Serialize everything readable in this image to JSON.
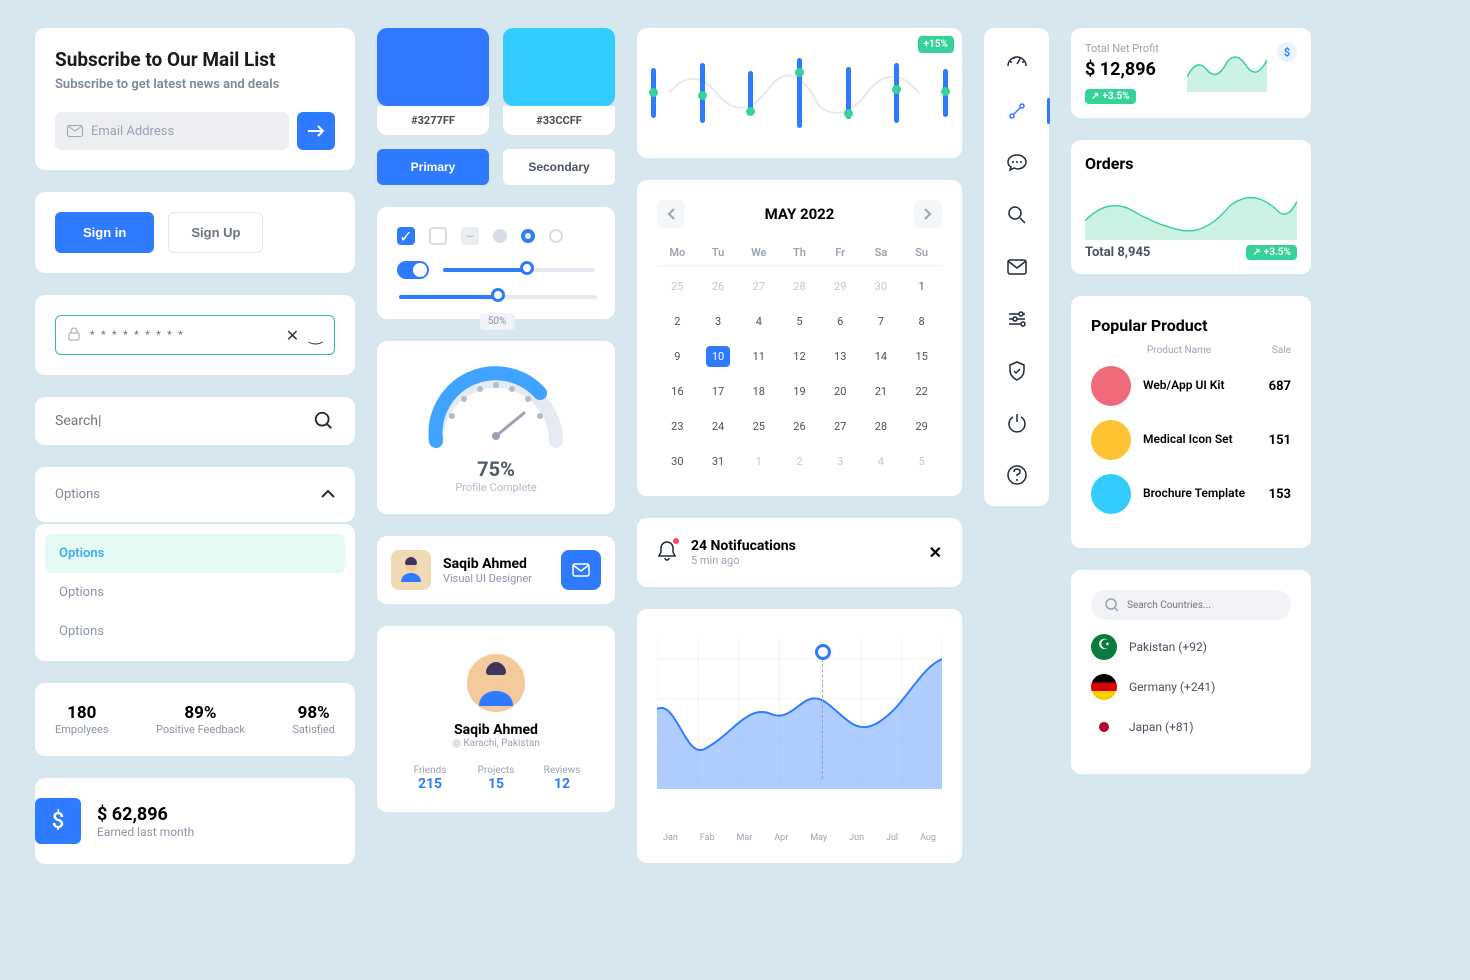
{
  "subscribe": {
    "title": "Subscribe to Our Mail List",
    "subtitle": "Subscribe to get latest news and deals",
    "placeholder": "Email Address"
  },
  "auth": {
    "signin": "Sign in",
    "signup": "Sign Up"
  },
  "password": {
    "masked": "* * * * * * * * *"
  },
  "search": {
    "placeholder": "Search|"
  },
  "options": {
    "label": "Options",
    "items": [
      "Options",
      "Options",
      "Options"
    ]
  },
  "stats": {
    "employees": {
      "num": "180",
      "label": "Empolyees"
    },
    "feedback": {
      "num": "89%",
      "label": "Positive Feedback"
    },
    "satisfied": {
      "num": "98%",
      "label": "Satisfied"
    }
  },
  "earned": {
    "amount": "$ 62,896",
    "label": "Earned last month"
  },
  "swatches": {
    "c1": "#3277FF",
    "c2": "#33CCFF",
    "l1": "#3277FF",
    "l2": "#33CCFF"
  },
  "buttons": {
    "primary": "Primary",
    "secondary": "Secondary"
  },
  "slider_tip": "50%",
  "gauge": {
    "value": "75%",
    "label": "Profile Complete"
  },
  "user": {
    "name": "Saqib Ahmed",
    "role": "Visual UI Designer"
  },
  "profile": {
    "name": "Saqib Ahmed",
    "location": "Karachi, Pakistan",
    "stats": {
      "friends": {
        "label": "Friends",
        "val": "215"
      },
      "projects": {
        "label": "Projects",
        "val": "15"
      },
      "reviews": {
        "label": "Reviews",
        "val": "12"
      }
    }
  },
  "chart_data": {
    "candle_chart": {
      "type": "line",
      "badge": "+15%",
      "points": [
        5,
        4,
        3.5,
        5,
        3,
        4,
        6
      ],
      "note": "decorative sparkline — values estimated"
    },
    "area_chart": {
      "type": "area",
      "x": [
        "Jan",
        "Fab",
        "Mar",
        "Apr",
        "May",
        "Jun",
        "Jul",
        "Aug"
      ],
      "values": [
        60,
        30,
        55,
        45,
        65,
        50,
        40,
        85
      ],
      "marker_index": 5,
      "ylim": [
        0,
        100
      ]
    },
    "net_profit_spark": {
      "type": "area",
      "values": [
        3,
        6,
        4,
        7,
        5,
        8,
        6
      ]
    },
    "orders_spark": {
      "type": "area",
      "values": [
        4,
        7,
        5,
        3,
        6,
        8,
        5,
        9
      ]
    }
  },
  "calendar": {
    "title": "MAY 2022",
    "dow": [
      "Mo",
      "Tu",
      "We",
      "Th",
      "Fr",
      "Sa",
      "Su"
    ],
    "days": [
      [
        25,
        26,
        27,
        28,
        29,
        30,
        1
      ],
      [
        2,
        3,
        4,
        5,
        6,
        7,
        8
      ],
      [
        9,
        10,
        11,
        12,
        13,
        14,
        15
      ],
      [
        16,
        17,
        18,
        19,
        20,
        21,
        22
      ],
      [
        23,
        24,
        25,
        26,
        27,
        28,
        29
      ],
      [
        30,
        31,
        1,
        2,
        3,
        4,
        5
      ]
    ],
    "active": 10
  },
  "notif": {
    "title": "24 Notifucations",
    "subtitle": "5 min ago"
  },
  "months": [
    "Jan",
    "Fab",
    "Mar",
    "Apr",
    "May",
    "Jun",
    "Jul",
    "Aug"
  ],
  "netprofit": {
    "label": "Total Net Profit",
    "amount": "$ 12,896",
    "delta": "+3.5%"
  },
  "orders": {
    "title": "Orders",
    "total": "Total 8,945",
    "delta": "+3.5%"
  },
  "popular": {
    "title": "Popular Product",
    "cols": {
      "name": "Product Name",
      "sale": "Sale"
    },
    "items": [
      {
        "name": "Web/App UI Kit",
        "sale": "687",
        "color": "#f06a7b"
      },
      {
        "name": "Medical Icon Set",
        "sale": "151",
        "color": "#ffc233"
      },
      {
        "name": "Brochure Template",
        "sale": "153",
        "color": "#33ccff"
      }
    ]
  },
  "countries": {
    "placeholder": "Search Countries...",
    "items": [
      {
        "name": "Pakistan (+92)",
        "flag": "pk"
      },
      {
        "name": "Germany (+241)",
        "flag": "de"
      },
      {
        "name": "Japan (+81)",
        "flag": "jp"
      }
    ]
  }
}
